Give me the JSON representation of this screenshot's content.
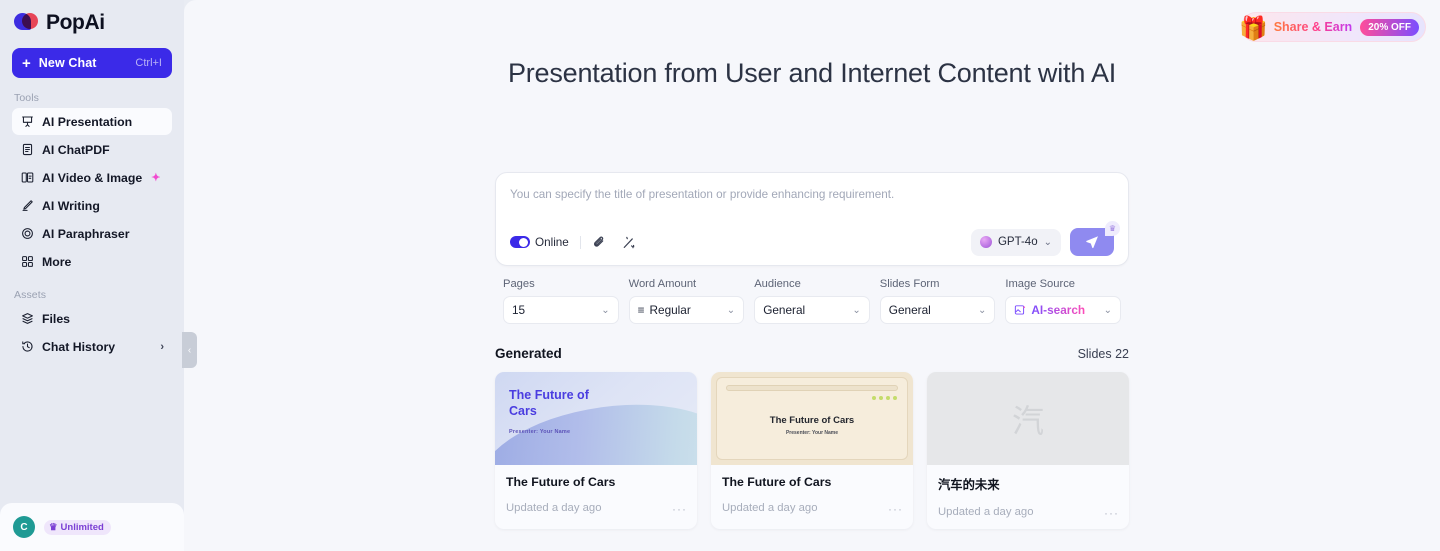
{
  "brand": {
    "name": "PopAi",
    "accent": "#3b2ae8"
  },
  "sidebar": {
    "new_chat": {
      "label": "New Chat",
      "shortcut": "Ctrl+I",
      "plus": "+"
    },
    "tools_label": "Tools",
    "tools": [
      {
        "label": "AI Presentation",
        "icon": "presentation-icon",
        "active": true
      },
      {
        "label": "AI ChatPDF",
        "icon": "document-icon",
        "active": false
      },
      {
        "label": "AI Video & Image",
        "icon": "video-image-icon",
        "active": false,
        "sparkle": "✦"
      },
      {
        "label": "AI Writing",
        "icon": "pencil-icon",
        "active": false
      },
      {
        "label": "AI Paraphraser",
        "icon": "spiral-icon",
        "active": false
      },
      {
        "label": "More",
        "icon": "grid-icon",
        "active": false
      }
    ],
    "assets_label": "Assets",
    "assets": [
      {
        "label": "Files",
        "icon": "layers-icon",
        "chevron": ""
      },
      {
        "label": "Chat History",
        "icon": "clock-history-icon",
        "chevron": "›"
      }
    ],
    "user": {
      "avatar_initial": "C",
      "plan_label": "Unlimited",
      "plan_icon": "♛"
    },
    "collapse_icon": "‹"
  },
  "header": {
    "share": {
      "label": "Share & Earn",
      "discount": "20% OFF",
      "icon": "gift-icon"
    }
  },
  "main": {
    "title": "Presentation from User and Internet Content with AI",
    "composer": {
      "placeholder": "You can specify the title of presentation or provide enhancing requirement.",
      "value": "",
      "online_label": "Online",
      "online_on": true,
      "attach_icon": "paperclip-icon",
      "magic_icon": "magic-wand-icon",
      "model": "GPT-4o",
      "model_chevron": "⌄",
      "send_icon": "send-icon",
      "send_badge_icon": "crown-icon"
    },
    "options": [
      {
        "label": "Pages",
        "value": "15",
        "icon": "",
        "chevron": "⌄"
      },
      {
        "label": "Word Amount",
        "value": "Regular",
        "icon": "≡",
        "chevron": "⌄"
      },
      {
        "label": "Audience",
        "value": "General",
        "icon": "",
        "chevron": "⌄"
      },
      {
        "label": "Slides Form",
        "value": "General",
        "icon": "",
        "chevron": "⌄"
      },
      {
        "label": "Image Source",
        "value": "AI-search",
        "icon": "image-ai-icon",
        "chevron": "⌄"
      }
    ],
    "generated": {
      "heading": "Generated",
      "count_label": "Slides 22",
      "cards": [
        {
          "title": "The Future of Cars",
          "updated": "Updated a day ago",
          "thumb_title": "The Future of Cars",
          "thumb_subtitle": "Presenter: Your Name",
          "more": "···"
        },
        {
          "title": "The Future of Cars",
          "updated": "Updated a day ago",
          "thumb_title": "The Future of Cars",
          "thumb_subtitle": "Presenter: Your Name",
          "more": "···"
        },
        {
          "title": "汽车的未来",
          "updated": "Updated a day ago",
          "thumb_title": "汽",
          "thumb_subtitle": "",
          "more": "···"
        }
      ]
    }
  }
}
